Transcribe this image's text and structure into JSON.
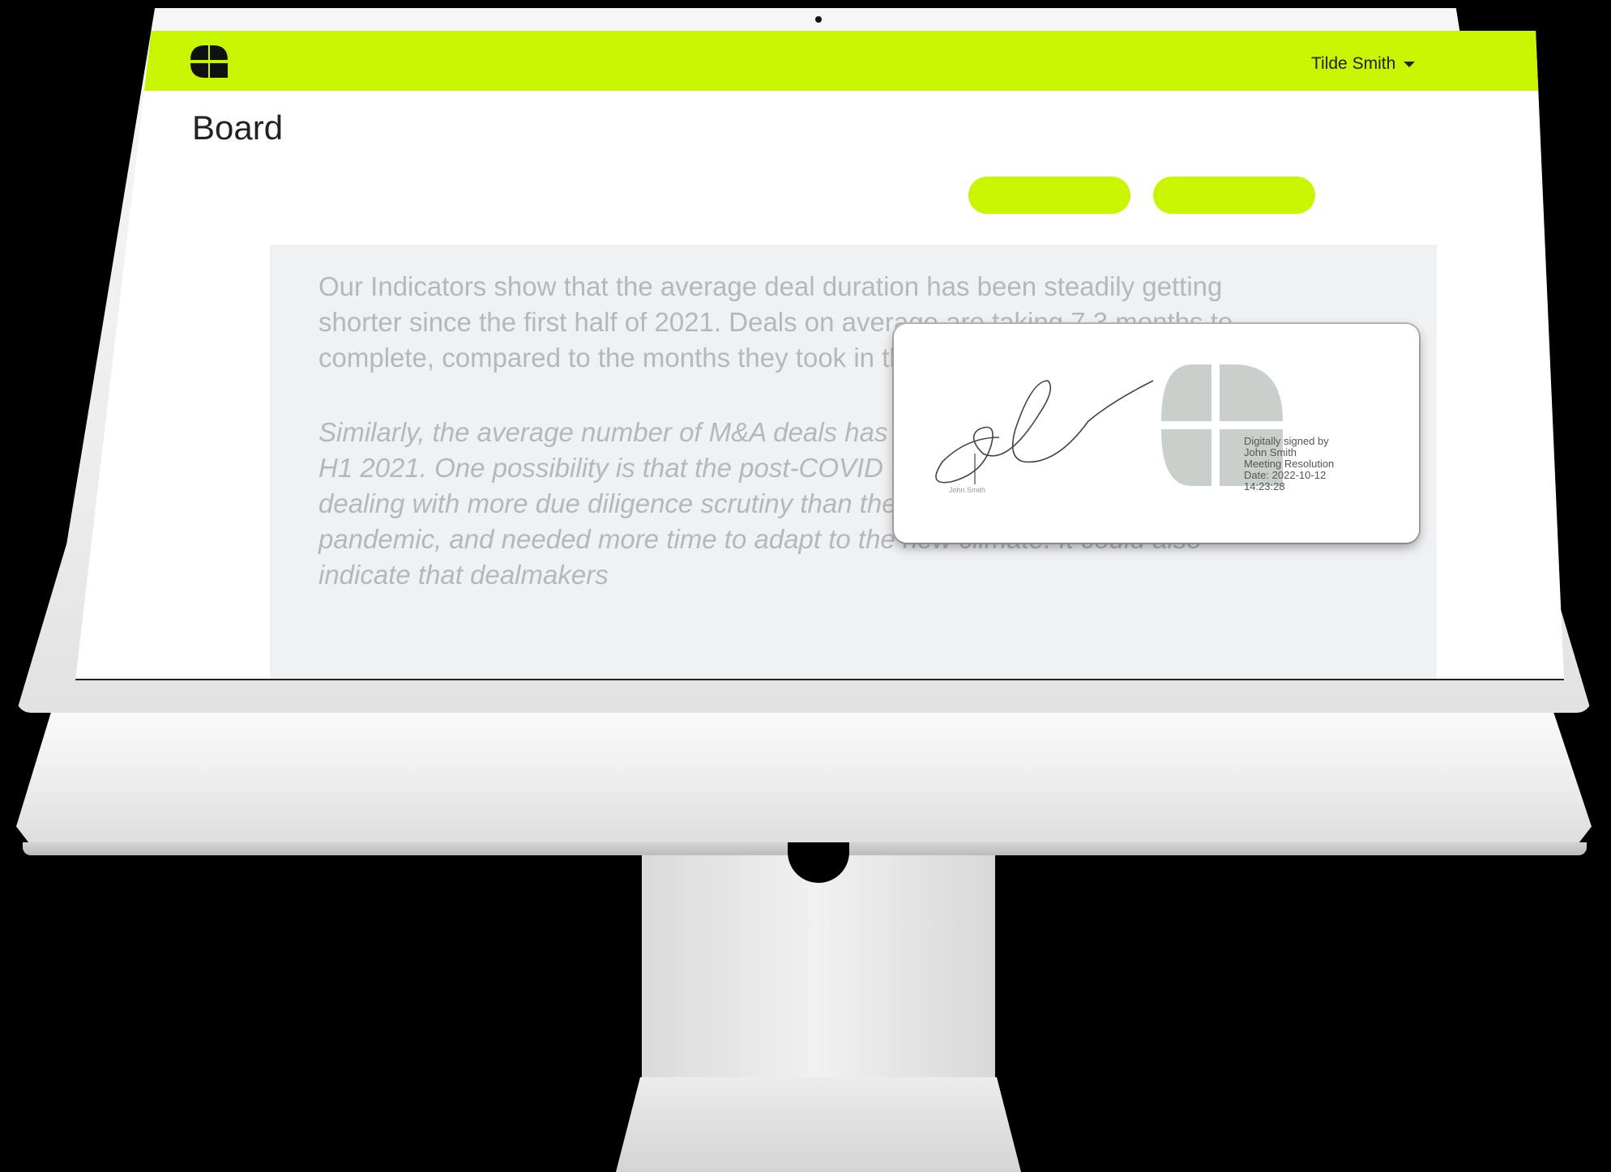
{
  "app": {
    "brand_color": "#c8f500",
    "logo_icon": "four-petal-logo-icon",
    "user_name": "Tilde Smith"
  },
  "page": {
    "title": "Board"
  },
  "document": {
    "paragraphs": [
      "Our Indicators show that the average deal duration has been steadily getting shorter since the first half of 2021. Deals on average are taking 7.3 months to complete, compared to the months they took in the first half of 2021.",
      "Similarly, the average number of M&A deals has reduced in size, going from 6.7 in H1 2021. One possibility is that the post-COVID transactions of early 2021 were dealing with more due diligence scrutiny than they were accustomed to before the pandemic, and needed more time to adapt to the new climate. It could also indicate that dealmakers"
    ]
  },
  "signature": {
    "signer_caption": "John Smith",
    "meta": {
      "line1": "Digitally signed by",
      "line2": "John Smith",
      "line3": "Meeting Resolution",
      "line4": "Date: 2022-10-12",
      "line5": "14:23:28"
    },
    "seal_color": "#c9cfcb"
  }
}
